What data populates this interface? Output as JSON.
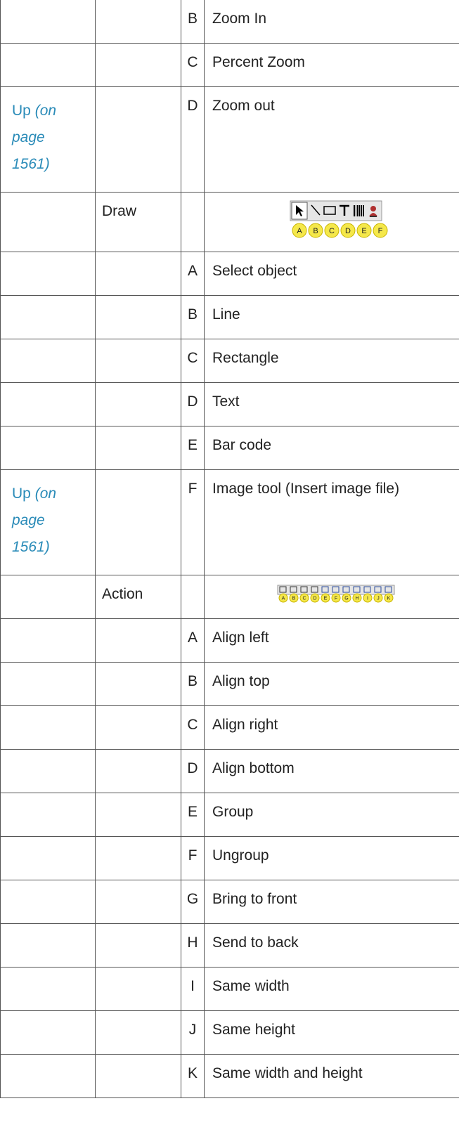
{
  "rows": [
    {
      "letter": "B",
      "text": "Zoom In"
    },
    {
      "letter": "C",
      "text": "Percent Zoom"
    },
    {
      "letter": "D",
      "text": "Zoom out",
      "up": {
        "word": "Up",
        "ref_lines": [
          "(on",
          "page",
          "1561)"
        ]
      }
    },
    {
      "section": "Draw",
      "toolbar": "draw-toolbar",
      "labels": [
        "A",
        "B",
        "C",
        "D",
        "E",
        "F"
      ]
    },
    {
      "letter": "A",
      "text": "Select object"
    },
    {
      "letter": "B",
      "text": "Line"
    },
    {
      "letter": "C",
      "text": "Rectangle"
    },
    {
      "letter": "D",
      "text": "Text"
    },
    {
      "letter": "E",
      "text": "Bar code"
    },
    {
      "letter": "F",
      "text": "Image tool (Insert image file)",
      "up": {
        "word": "Up",
        "ref_lines": [
          "(on",
          "page",
          "1561)"
        ]
      }
    },
    {
      "section": "Action",
      "toolbar": "action-toolbar",
      "labels": [
        "A",
        "B",
        "C",
        "D",
        "E",
        "F",
        "G",
        "H",
        "I",
        "J",
        "K"
      ]
    },
    {
      "letter": "A",
      "text": "Align left"
    },
    {
      "letter": "B",
      "text": "Align top"
    },
    {
      "letter": "C",
      "text": "Align right"
    },
    {
      "letter": "D",
      "text": "Align bottom"
    },
    {
      "letter": "E",
      "text": "Group"
    },
    {
      "letter": "F",
      "text": "Ungroup"
    },
    {
      "letter": "G",
      "text": "Bring to front"
    },
    {
      "letter": "H",
      "text": "Send to back"
    },
    {
      "letter": "I",
      "text": "Same width"
    },
    {
      "letter": "J",
      "text": "Same height"
    },
    {
      "letter": "K",
      "text": "Same width and height"
    }
  ],
  "colors": {
    "link": "#2a8bb8",
    "badge_fill": "#f5e84a",
    "badge_stroke": "#c8b400",
    "rule": "#555555"
  }
}
